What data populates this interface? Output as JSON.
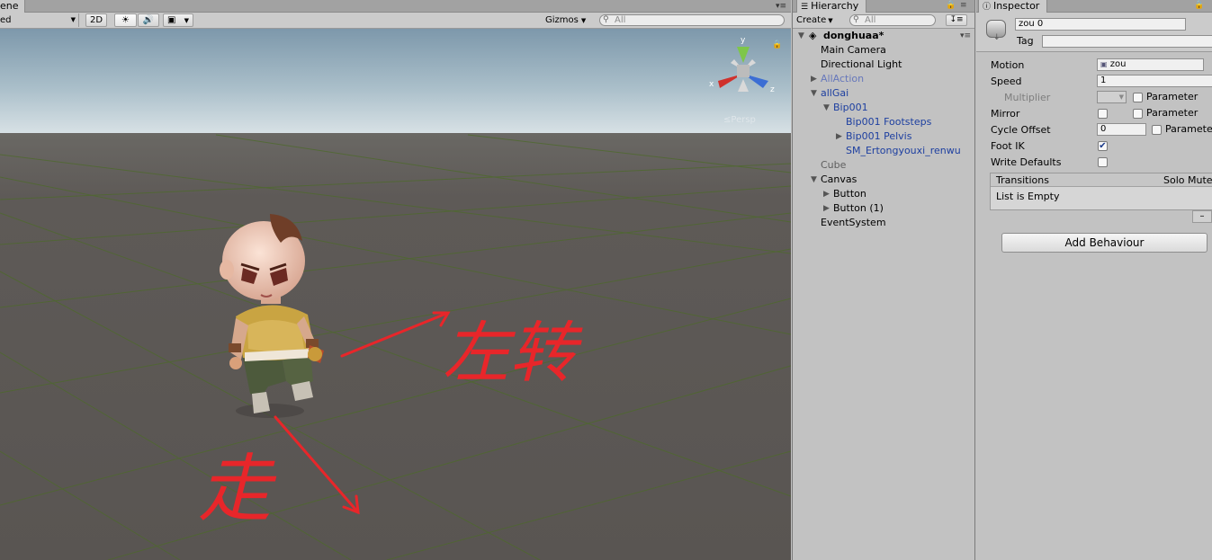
{
  "scene": {
    "tab_label": "ene",
    "shading_mode": "ed",
    "toggle_2d": "2D",
    "gizmos_label": "Gizmos",
    "search_placeholder": "All",
    "axis_labels": {
      "y": "y",
      "x": "x",
      "z": "z"
    },
    "persp_label": "Persp",
    "annotations": {
      "left_turn": "左转",
      "walk": "走"
    },
    "colors": {
      "ground": "#595552",
      "sky": "#8fa9b9",
      "annotation": "#e8262a"
    }
  },
  "hierarchy": {
    "tab_label": "Hierarchy",
    "create_label": "Create",
    "search_placeholder": "All",
    "scene_name": "donghuaa*",
    "items": [
      {
        "label": "Main Camera",
        "depth": 0,
        "arrow": "",
        "style": "normal"
      },
      {
        "label": "Directional Light",
        "depth": 0,
        "arrow": "",
        "style": "normal"
      },
      {
        "label": "AllAction",
        "depth": 0,
        "arrow": "▶",
        "style": "lightblue"
      },
      {
        "label": "allGai",
        "depth": 0,
        "arrow": "▼",
        "style": "blue"
      },
      {
        "label": "Bip001",
        "depth": 1,
        "arrow": "▼",
        "style": "blue"
      },
      {
        "label": "Bip001 Footsteps",
        "depth": 2,
        "arrow": "",
        "style": "blue"
      },
      {
        "label": "Bip001 Pelvis",
        "depth": 2,
        "arrow": "▶",
        "style": "blue"
      },
      {
        "label": "SM_Ertongyouxi_renwu",
        "depth": 2,
        "arrow": "",
        "style": "blue"
      },
      {
        "label": "Cube",
        "depth": 0,
        "arrow": "",
        "style": "grey"
      },
      {
        "label": "Canvas",
        "depth": 0,
        "arrow": "▼",
        "style": "normal"
      },
      {
        "label": "Button",
        "depth": 1,
        "arrow": "▶",
        "style": "normal"
      },
      {
        "label": "Button (1)",
        "depth": 1,
        "arrow": "▶",
        "style": "normal"
      },
      {
        "label": "EventSystem",
        "depth": 0,
        "arrow": "",
        "style": "normal"
      }
    ]
  },
  "inspector": {
    "tab_label": "Inspector",
    "name_value": "zou 0",
    "tag_label": "Tag",
    "motion_label": "Motion",
    "motion_value": "zou",
    "speed_label": "Speed",
    "speed_value": "1",
    "multiplier_label": "Multiplier",
    "parameter_label": "Parameter",
    "mirror_label": "Mirror",
    "cycle_offset_label": "Cycle Offset",
    "cycle_offset_value": "0",
    "parameter_label_cut": "Paramete",
    "foot_ik_label": "Foot IK",
    "foot_ik_checked": true,
    "write_defaults_label": "Write Defaults",
    "transitions_label": "Transitions",
    "solo_mute_label": "Solo Mute",
    "list_empty_label": "List is Empty",
    "minus_label": "–",
    "add_behaviour_label": "Add Behaviour"
  }
}
